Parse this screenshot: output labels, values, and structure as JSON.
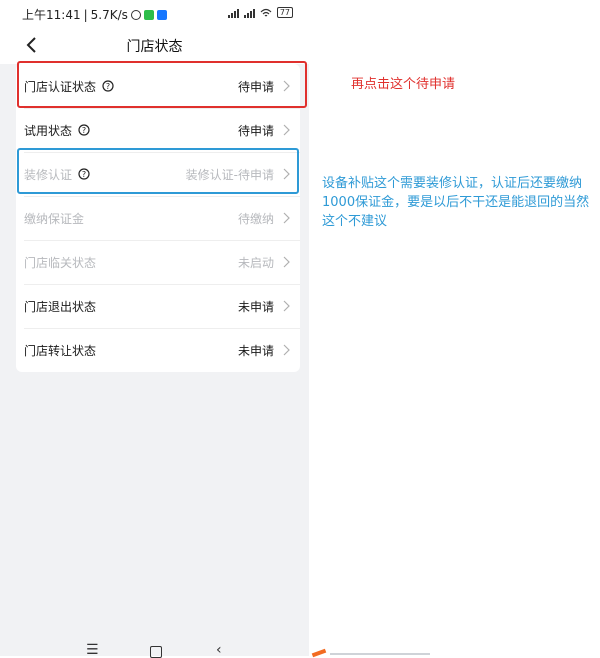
{
  "statusbar": {
    "time": "上午11:41",
    "speed": "5.7K/s",
    "battery": "77"
  },
  "header": {
    "title": "门店状态"
  },
  "rows": [
    {
      "label": "门店认证状态",
      "value": "待申请",
      "has_help": true,
      "disabled": false
    },
    {
      "label": "试用状态",
      "value": "待申请",
      "has_help": true,
      "disabled": false
    },
    {
      "label": "装修认证",
      "value": "装修认证-待申请",
      "has_help": true,
      "disabled": true
    },
    {
      "label": "缴纳保证金",
      "value": "待缴纳",
      "has_help": false,
      "disabled": true
    },
    {
      "label": "门店临关状态",
      "value": "未启动",
      "has_help": false,
      "disabled": true
    },
    {
      "label": "门店退出状态",
      "value": "未申请",
      "has_help": false,
      "disabled": false
    },
    {
      "label": "门店转让状态",
      "value": "未申请",
      "has_help": false,
      "disabled": false
    }
  ],
  "annotations": {
    "red_note": "再点击这个待申请",
    "blue_note": "设备补贴这个需要装修认证，认证后还要缴纳1000保证金，要是以后不干还是能退回的当然这个不建议"
  },
  "colors": {
    "annotation_red": "#e0302d",
    "annotation_blue": "#2e9ad6",
    "page_bg": "#f1f2f4",
    "disabled_text": "#b7b9bd"
  },
  "icons": [
    "back-arrow-icon",
    "help-circle-icon",
    "chevron-right-icon",
    "menu-icon",
    "home-icon",
    "back-icon"
  ]
}
